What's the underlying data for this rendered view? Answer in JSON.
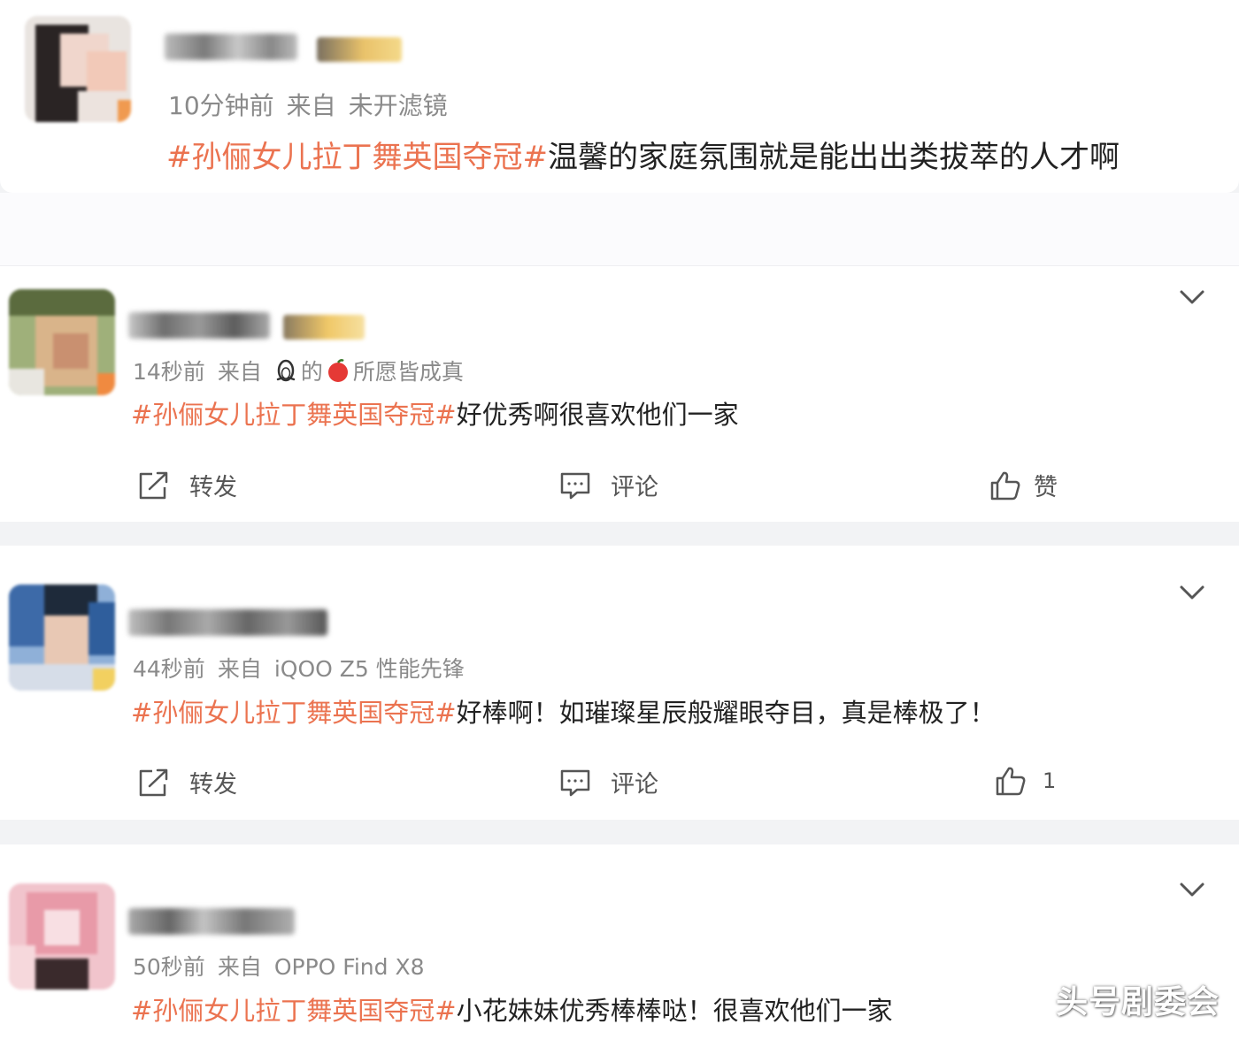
{
  "posts": [
    {
      "time": "10分钟前",
      "source_prefix": "来自",
      "source": "未开滤镜",
      "tag": "#孙俪女儿拉丁舞英国夺冠#",
      "text": "温馨的家庭氛围就是能出出类拔萃的人才啊"
    },
    {
      "time": "14秒前",
      "source_prefix": "来自",
      "source": "的",
      "source_suffix": "所愿皆成真",
      "source_icons": [
        "penguin-icon",
        "apple-icon"
      ],
      "tag": "#孙俪女儿拉丁舞英国夺冠#",
      "text": "好优秀啊很喜欢他们一家",
      "actions": {
        "repost": "转发",
        "comment": "评论",
        "like": "赞"
      }
    },
    {
      "time": "44秒前",
      "source_prefix": "来自",
      "source": "iQOO Z5 性能先锋",
      "tag": "#孙俪女儿拉丁舞英国夺冠#",
      "text": "好棒啊！如璀璨星辰般耀眼夺目，真是棒极了！",
      "actions": {
        "repost": "转发",
        "comment": "评论",
        "like": "1"
      }
    },
    {
      "time": "50秒前",
      "source_prefix": "来自",
      "source": "OPPO Find X8",
      "tag": "#孙俪女儿拉丁舞英国夺冠#",
      "text": "小花妹妹优秀棒棒哒！很喜欢他们一家"
    }
  ],
  "watermark": "头号剧委会",
  "colors": {
    "tag": "#eb7350",
    "meta": "#8a8a8a",
    "background": "#f2f3f5"
  }
}
